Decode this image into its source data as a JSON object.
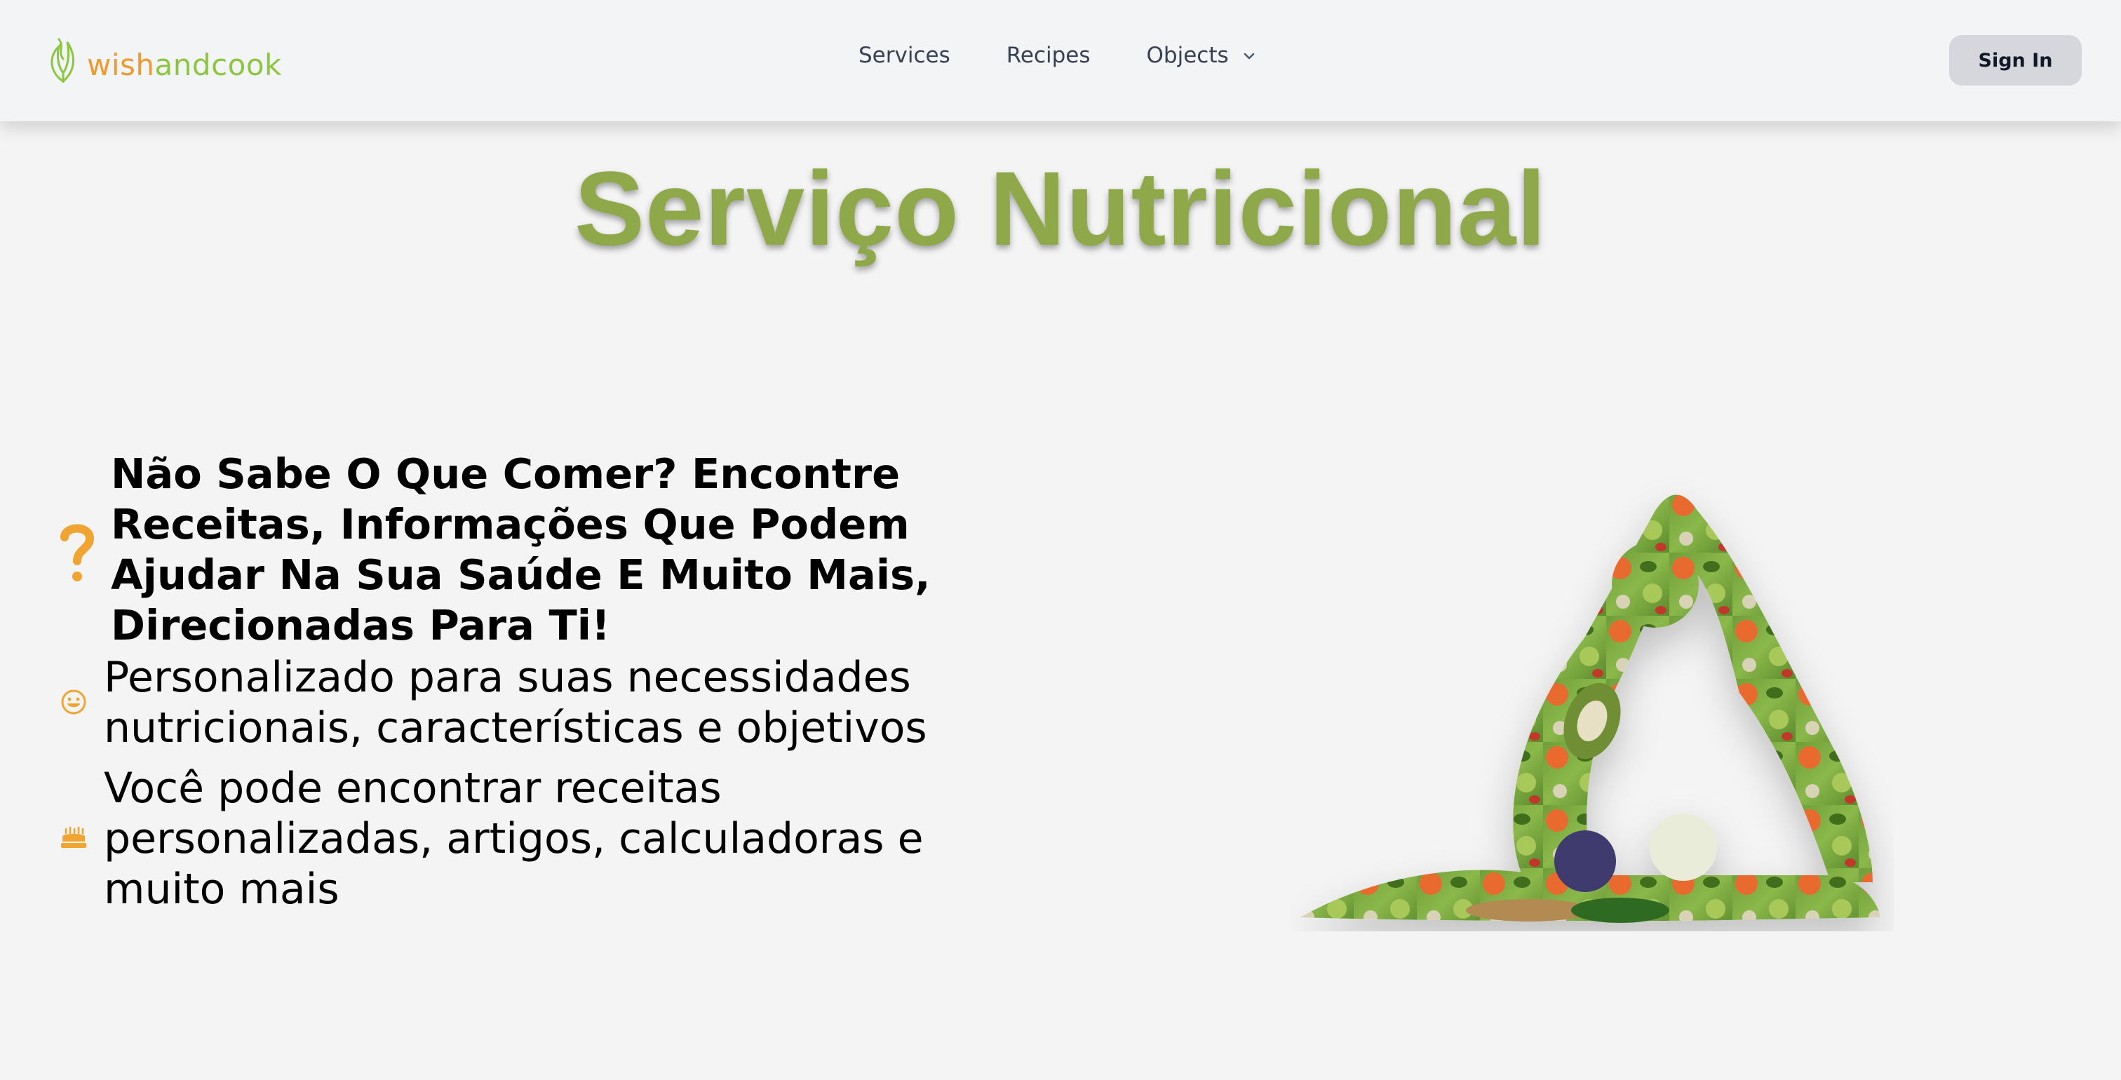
{
  "header": {
    "logo": {
      "part1": "wish",
      "part2": "and",
      "part3": "cook"
    },
    "nav": [
      {
        "label": "Services"
      },
      {
        "label": "Recipes"
      },
      {
        "label": "Objects"
      }
    ],
    "sign_in_label": "Sign In"
  },
  "main": {
    "title": "Serviço Nutricional",
    "features": [
      {
        "icon": "question-icon",
        "text": "Não Sabe O Que Comer? Encontre Receitas, Informações Que Podem Ajudar Na Sua Saúde E Muito Mais, Direcionadas Para Ti!"
      },
      {
        "icon": "smile-icon",
        "text": "Personalizado para suas necessidades nutricionais, características e objetivos"
      },
      {
        "icon": "cake-icon",
        "text": "Você pode encontrar receitas personalizadas, artigos, calculadoras e muito mais"
      }
    ],
    "illustration": {
      "icon": "vegetable-yoga-figure"
    }
  },
  "colors": {
    "title_green": "#8fa84a",
    "accent_orange": "#f0a431",
    "logo_green": "#8cc63f",
    "logo_orange": "#ee9a2e",
    "page_bg": "#f4f4f5",
    "header_bg": "#f3f4f6",
    "signin_bg": "#d5d7dc"
  }
}
